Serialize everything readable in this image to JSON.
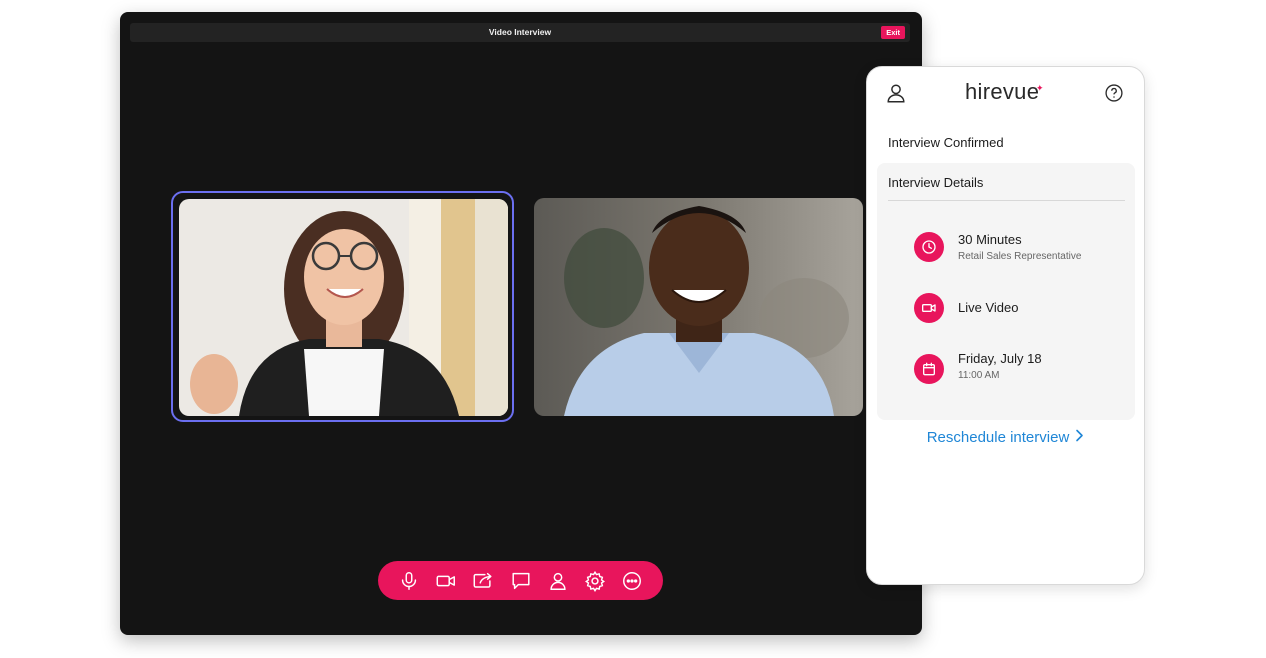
{
  "window": {
    "title": "Video Interview",
    "exit_label": "Exit"
  },
  "controls": {
    "icons": [
      "microphone-icon",
      "camera-icon",
      "share-screen-icon",
      "chat-icon",
      "participant-icon",
      "settings-icon",
      "more-icon"
    ]
  },
  "panel": {
    "logo": "hirevue",
    "confirmed_label": "Interview Confirmed",
    "details_title": "Interview Details",
    "details": [
      {
        "icon": "clock-icon",
        "main": "30 Minutes",
        "sub": "Retail Sales Representative"
      },
      {
        "icon": "video-icon",
        "main": "Live Video",
        "sub": ""
      },
      {
        "icon": "calendar-icon",
        "main": "Friday, July 18",
        "sub": "11:00 AM"
      }
    ],
    "reschedule_label": "Reschedule interview"
  },
  "colors": {
    "accent": "#e8155c",
    "link": "#1f86d6",
    "active_speaker_border": "#6b6ff0",
    "window_bg": "#141414"
  }
}
